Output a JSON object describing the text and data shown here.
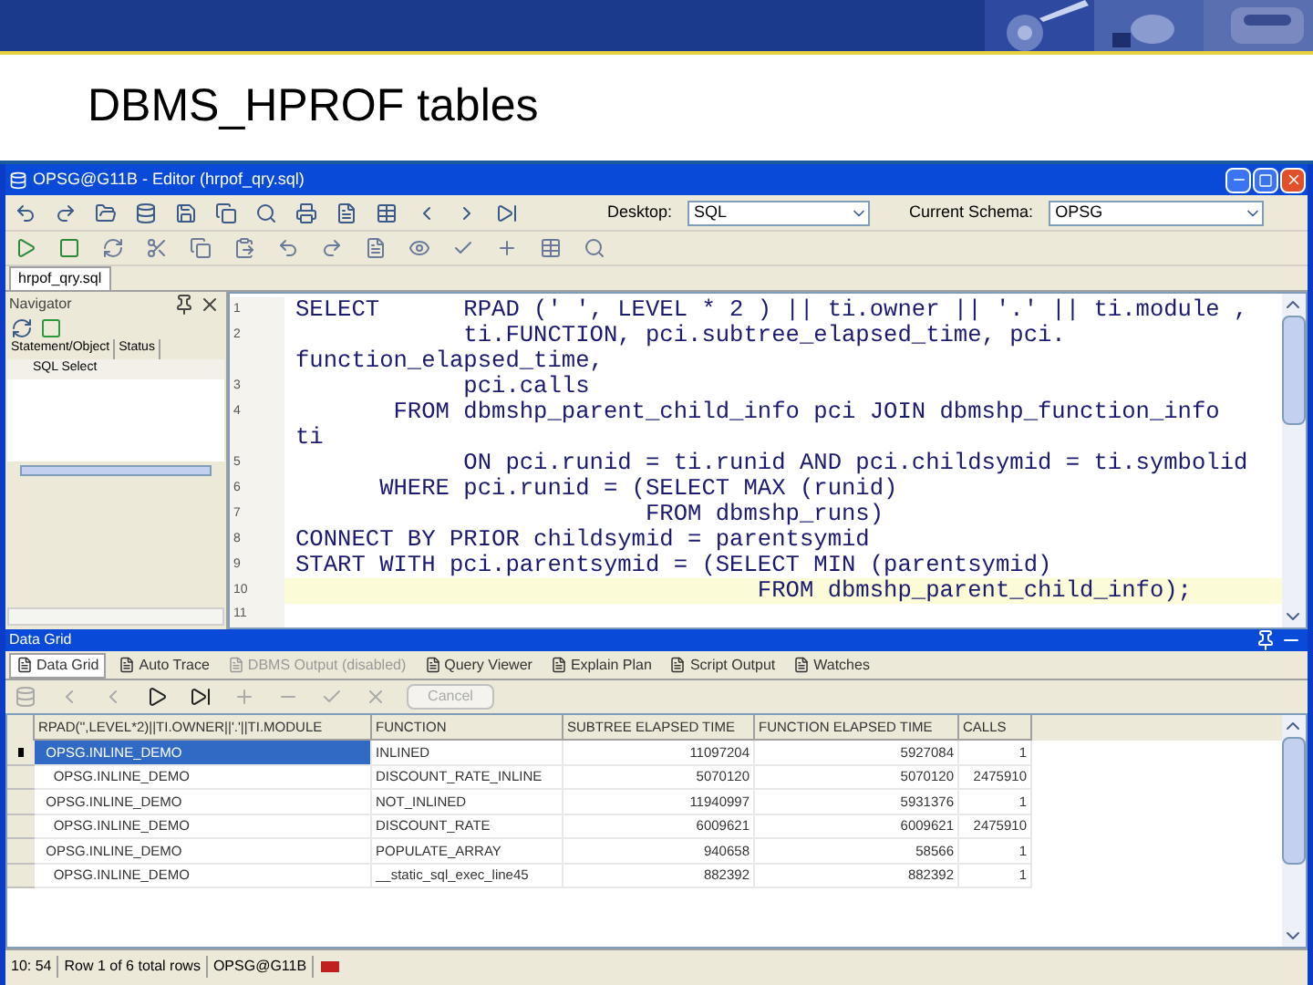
{
  "slide": {
    "title": "DBMS_HPROF tables"
  },
  "window": {
    "title": "OPSG@G11B - Editor (hrpof_qry.sql)"
  },
  "toolbar": {
    "desktop_label": "Desktop:",
    "desktop_value": "SQL",
    "schema_label": "Current Schema:",
    "schema_value": "OPSG"
  },
  "file_tabs": [
    {
      "label": "hrpof_qry.sql",
      "selected": true
    }
  ],
  "navigator": {
    "title": "Navigator",
    "columns": [
      "Statement/Object",
      "Status"
    ],
    "rows": [
      "SQL Select"
    ]
  },
  "editor": {
    "lines": [
      {
        "number": "1",
        "text": "SELECT      RPAD (' ', LEVEL * 2 ) || ti.owner || '.' || ti.module ,",
        "current": false
      },
      {
        "number": "2",
        "text": "            ti.FUNCTION, pci.subtree_elapsed_time, pci.",
        "current": false
      },
      {
        "text": "function_elapsed_time,",
        "current": false
      },
      {
        "number": "3",
        "text": "            pci.calls",
        "current": false
      },
      {
        "number": "4",
        "text": "       FROM dbmshp_parent_child_info pci JOIN dbmshp_function_info",
        "current": false
      },
      {
        "text": "ti",
        "current": false
      },
      {
        "number": "5",
        "text": "            ON pci.runid = ti.runid AND pci.childsymid = ti.symbolid",
        "current": false
      },
      {
        "number": "6",
        "text": "      WHERE pci.runid = (SELECT MAX (runid)",
        "current": false
      },
      {
        "number": "7",
        "text": "                         FROM dbmshp_runs)",
        "current": false
      },
      {
        "number": "8",
        "text": "CONNECT BY PRIOR childsymid = parentsymid",
        "current": false
      },
      {
        "number": "9",
        "text": "START WITH pci.parentsymid = (SELECT MIN (parentsymid)",
        "current": false
      },
      {
        "number": "10",
        "text": "                                 FROM dbmshp_parent_child_info);",
        "current": true
      },
      {
        "number": "11",
        "current": false
      }
    ]
  },
  "data_grid": {
    "title": "Data Grid",
    "tabs": [
      {
        "label": "Data Grid",
        "selected": true,
        "disabled": false
      },
      {
        "label": "Auto Trace",
        "selected": false,
        "disabled": false
      },
      {
        "label": "DBMS Output (disabled)",
        "selected": false,
        "disabled": true
      },
      {
        "label": "Query Viewer",
        "selected": false,
        "disabled": false
      },
      {
        "label": "Explain Plan",
        "selected": false,
        "disabled": false
      },
      {
        "label": "Script Output",
        "selected": false,
        "disabled": false
      },
      {
        "label": "Watches",
        "selected": false,
        "disabled": false
      }
    ],
    "cancel_button": {
      "label": "Cancel",
      "disabled": true
    },
    "columns": [
      "RPAD('',LEVEL*2)||TI.OWNER||'.'||TI.MODULE",
      "FUNCTION",
      "SUBTREE ELAPSED TIME",
      "FUNCTION ELAPSED TIME",
      "CALLS"
    ],
    "rows": [
      {
        "cells": [
          "  OPSG.INLINE_DEMO",
          "INLINED",
          "11097204",
          "5927084",
          "1"
        ],
        "selected": true
      },
      {
        "cells": [
          "    OPSG.INLINE_DEMO",
          "DISCOUNT_RATE_INLINE",
          "5070120",
          "5070120",
          "2475910"
        ],
        "selected": false
      },
      {
        "cells": [
          "  OPSG.INLINE_DEMO",
          "NOT_INLINED",
          "11940997",
          "5931376",
          "1"
        ],
        "selected": false
      },
      {
        "cells": [
          "    OPSG.INLINE_DEMO",
          "DISCOUNT_RATE",
          "6009621",
          "6009621",
          "2475910"
        ],
        "selected": false
      },
      {
        "cells": [
          "  OPSG.INLINE_DEMO",
          "POPULATE_ARRAY",
          "940658",
          "58566",
          "1"
        ],
        "selected": false
      },
      {
        "cells": [
          "    OPSG.INLINE_DEMO",
          "__static_sql_exec_line45",
          "882392",
          "882392",
          "1"
        ],
        "selected": false
      }
    ]
  },
  "status_bar": {
    "position": "10: 54",
    "rows": "Row 1 of 6 total rows",
    "connection": "OPSG@G11B"
  }
}
